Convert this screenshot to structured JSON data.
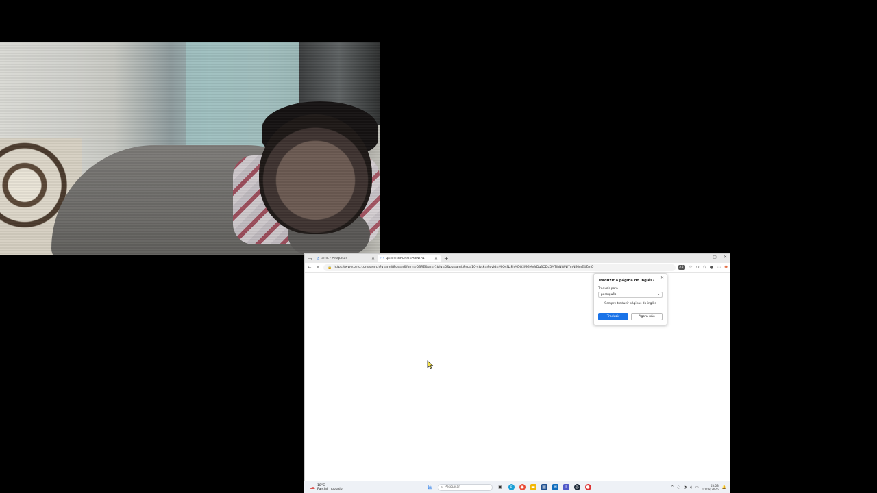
{
  "browser": {
    "tabs": [
      {
        "label": "amit - Pesquisar",
        "icon": "search-icon",
        "active": false
      },
      {
        "label": "q=amit&FORM=ANNTA1",
        "icon": "loading-icon",
        "active": true
      }
    ],
    "new_tab_label": "+",
    "window_controls": {
      "minimize": "–",
      "restore": "▢",
      "close": "✕"
    },
    "url": "https://www.bing.com/search?q=amit&qs=n&form=QBRE&sp=-1&lq=0&pq=amit&sc=10-4&sk=&cvid=MjQ4NzFhMDQ2MGMyNDg3ODg5MTlhNWNlYmNlMmE4ZmQ",
    "translate_badge": "A文"
  },
  "translate_popup": {
    "title": "Traduzir a página do inglês?",
    "target_label": "Traduzir para",
    "target_value": "português",
    "always_label": "Sempre traduzir páginas do inglês",
    "translate_button": "Traduzir",
    "not_now_button": "Agora não"
  },
  "taskbar": {
    "weather_temp": "18°C",
    "weather_desc": "Parcial. nublado",
    "search_placeholder": "Pesquisar",
    "time": "03:03",
    "date": "10/08/2025"
  },
  "colors": {
    "accent": "#1a73e8",
    "taskbar_bg": "#eef1f6"
  }
}
